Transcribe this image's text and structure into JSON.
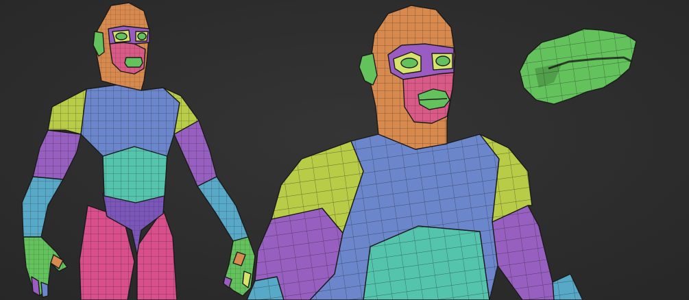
{
  "scene": {
    "background": "#2f2f2f",
    "palette": {
      "head": "#d88a4e",
      "face": "#d95a86",
      "mask": "#9a5cc0",
      "eye": "#d6e36a",
      "ear_lips": "#63c25c",
      "shoulder": "#b8cc48",
      "chest": "#6c86cc",
      "belly": "#55c4ad",
      "upper_arm": "#9760c0",
      "forearm": "#58a9c8",
      "pelvis": "#7a56b8",
      "legs": "#d94f8c",
      "hand": "#63c25c"
    },
    "views": [
      {
        "id": "full-body",
        "panels": [
          "head",
          "face",
          "mask",
          "eye",
          "ear",
          "shoulder-left",
          "shoulder-right",
          "chest",
          "belly",
          "upper-arm-left",
          "upper-arm-right",
          "forearm-left",
          "forearm-right",
          "pelvis",
          "leg-left",
          "leg-right",
          "hand-left",
          "hand-right"
        ]
      },
      {
        "id": "bust-closeup",
        "panels": [
          "head",
          "face",
          "mask",
          "eye",
          "ear",
          "lips",
          "shoulder-left",
          "shoulder-right",
          "chest",
          "belly",
          "upper-arm-left",
          "upper-arm-right",
          "forearm-left",
          "forearm-right"
        ]
      },
      {
        "id": "lips-detail",
        "panels": [
          "lips"
        ]
      }
    ]
  }
}
